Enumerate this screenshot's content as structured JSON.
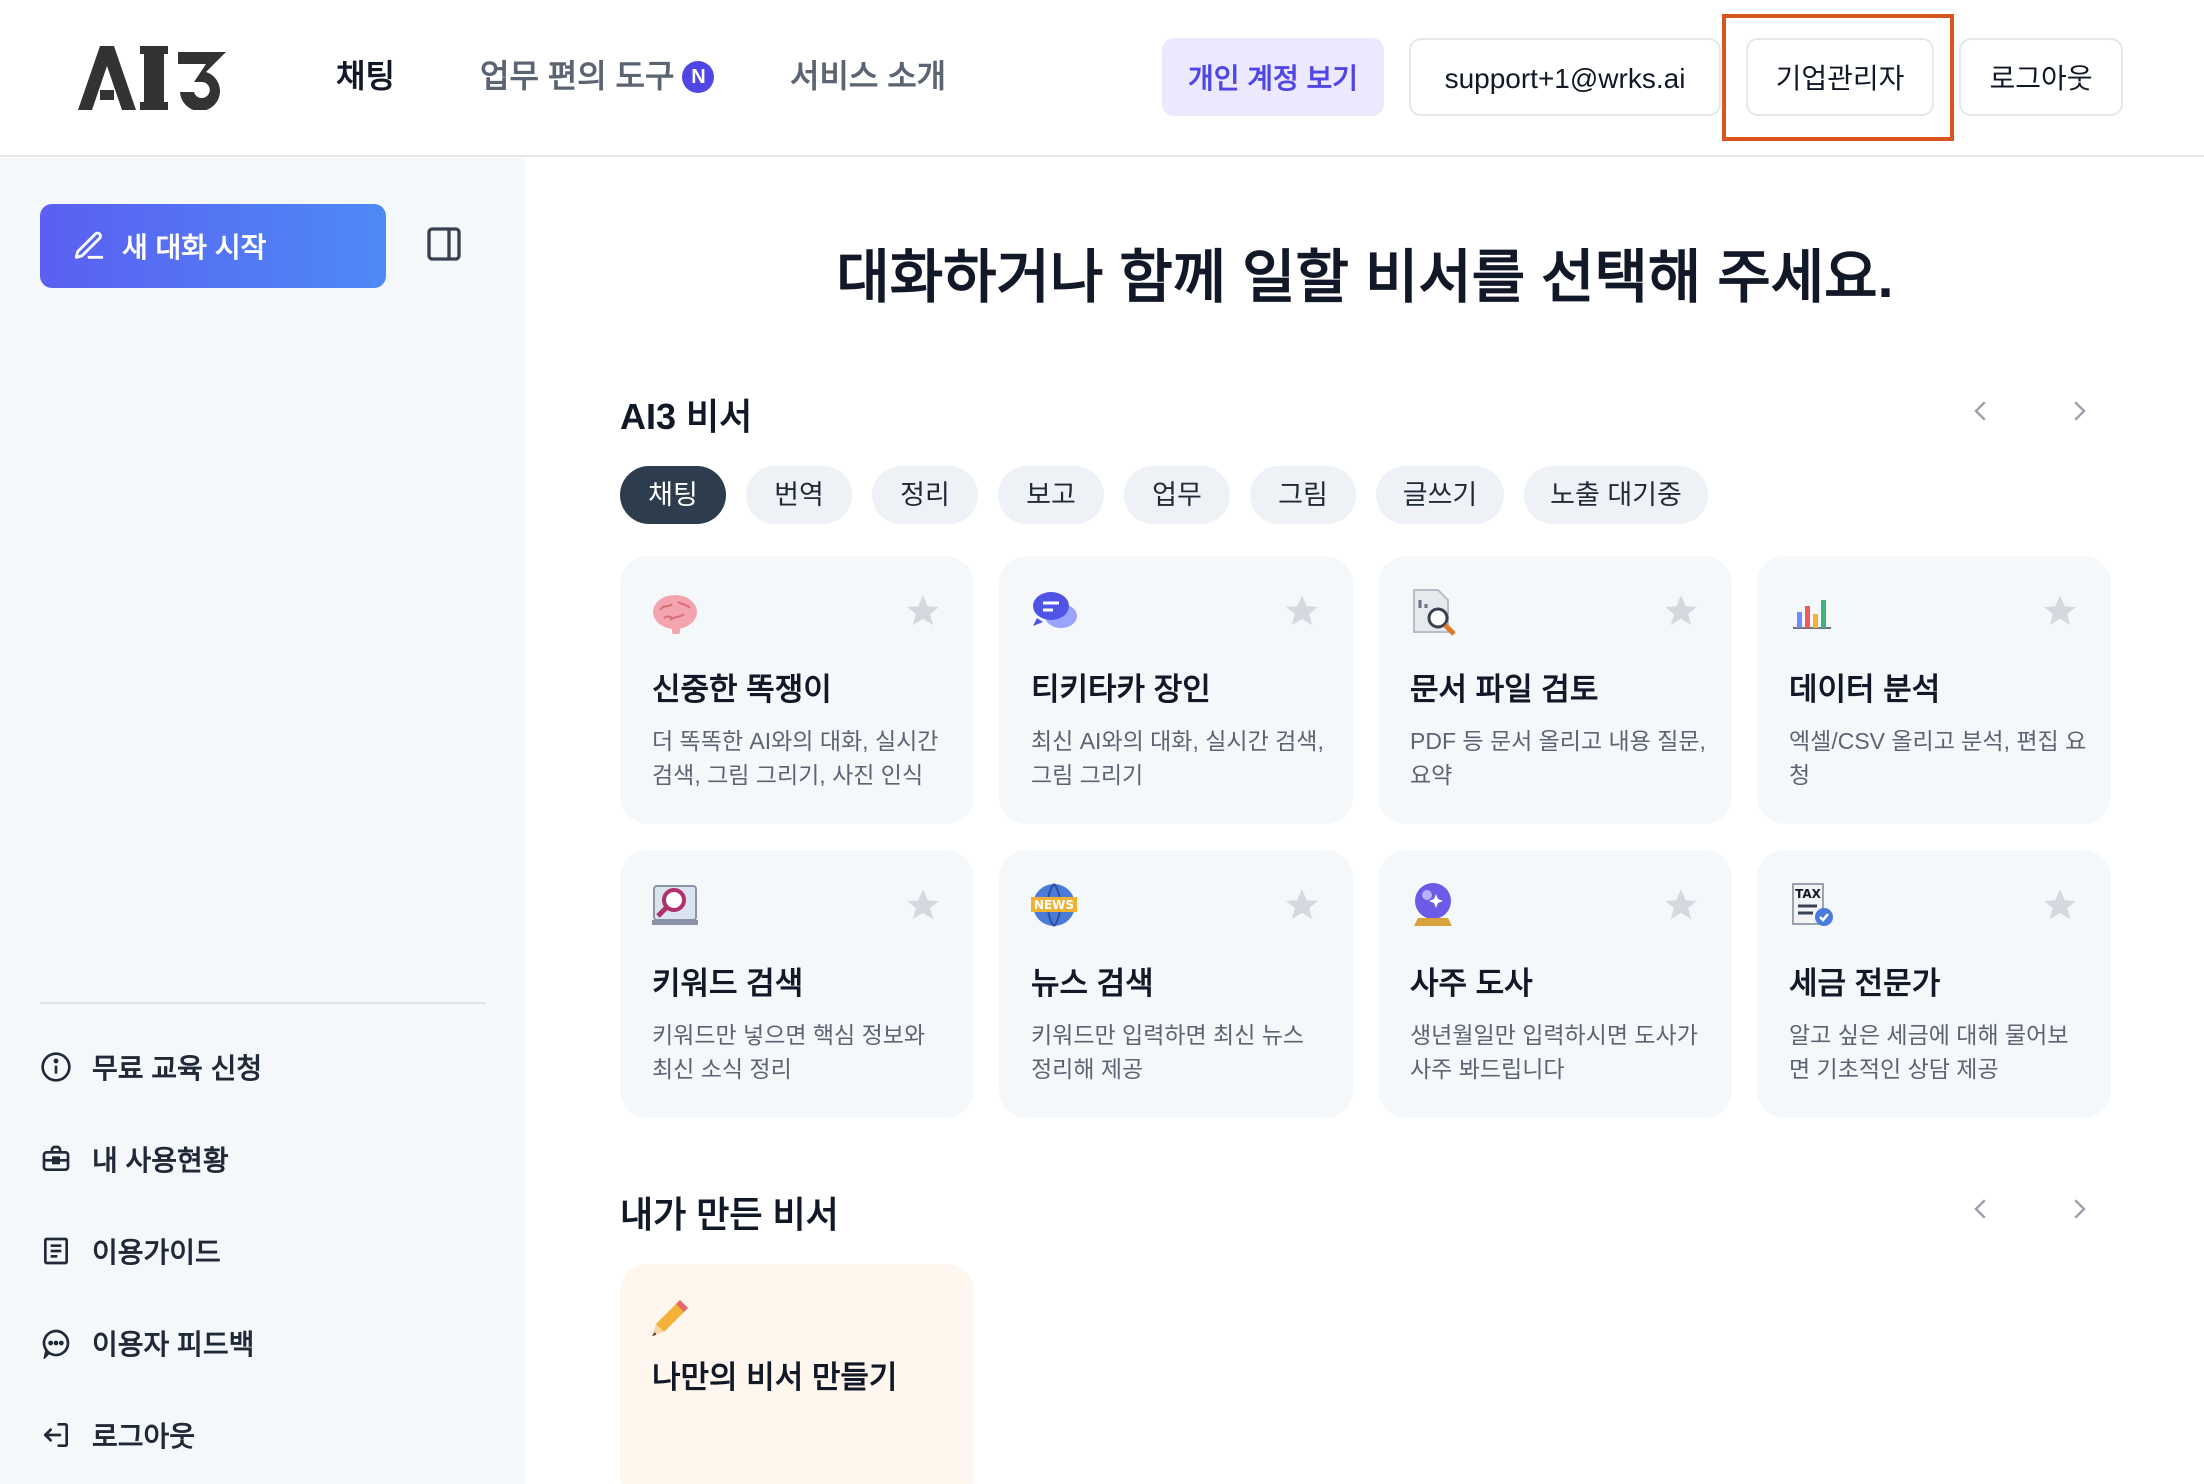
{
  "header": {
    "logo_text": "AI3",
    "nav": [
      {
        "label": "채팅"
      },
      {
        "label": "업무 편의 도구",
        "badge": "N"
      },
      {
        "label": "서비스 소개"
      }
    ],
    "buttons": {
      "personal_account": "개인 계정 보기",
      "email": "support+1@wrks.ai",
      "enterprise_admin": "기업관리자",
      "logout": "로그아웃"
    }
  },
  "sidebar": {
    "new_chat_label": "새 대화 시작",
    "items": [
      {
        "label": "무료 교육 신청",
        "icon": "info-icon"
      },
      {
        "label": "내 사용현황",
        "icon": "briefcase-icon"
      },
      {
        "label": "이용가이드",
        "icon": "document-icon"
      },
      {
        "label": "이용자 피드백",
        "icon": "chat-bubble-icon"
      },
      {
        "label": "로그아웃",
        "icon": "logout-icon"
      }
    ]
  },
  "main": {
    "title": "대화하거나 함께 일할 비서를 선택해 주세요.",
    "ai3_section": {
      "title": "AI3 비서",
      "tabs": [
        "채팅",
        "번역",
        "정리",
        "보고",
        "업무",
        "그림",
        "글쓰기",
        "노출 대기중"
      ],
      "active_tab": "채팅",
      "cards": [
        {
          "title": "신중한 똑쟁이",
          "desc": "더 똑똑한 AI와의 대화, 실시간 검색, 그림 그리기, 사진 인식",
          "icon": "brain-icon"
        },
        {
          "title": "티키타카 장인",
          "desc": "최신 AI와의 대화, 실시간 검색, 그림 그리기",
          "icon": "chat-icon"
        },
        {
          "title": "문서 파일 검토",
          "desc": "PDF 등 문서 올리고 내용 질문, 요약",
          "icon": "document-search-icon"
        },
        {
          "title": "데이터 분석",
          "desc": "엑셀/CSV 올리고 분석, 편집 요청",
          "icon": "bar-chart-icon"
        },
        {
          "title": "키워드 검색",
          "desc": "키워드만 넣으면 핵심 정보와 최신 소식 정리",
          "icon": "magnifier-icon"
        },
        {
          "title": "뉴스 검색",
          "desc": "키워드만 입력하면 최신 뉴스 정리해 제공",
          "icon": "news-icon"
        },
        {
          "title": "사주 도사",
          "desc": "생년월일만 입력하시면 도사가 사주 봐드립니다",
          "icon": "crystal-ball-icon"
        },
        {
          "title": "세금 전문가",
          "desc": "알고 싶은 세금에 대해 물어보면 기초적인 상담 제공",
          "icon": "tax-icon"
        }
      ]
    },
    "my_section": {
      "title": "내가 만든 비서",
      "make_card_title": "나만의 비서 만들기"
    }
  },
  "colors": {
    "accent": "#4f46e5",
    "highlight": "#d9541e",
    "active_chip": "#2d3d4d"
  }
}
